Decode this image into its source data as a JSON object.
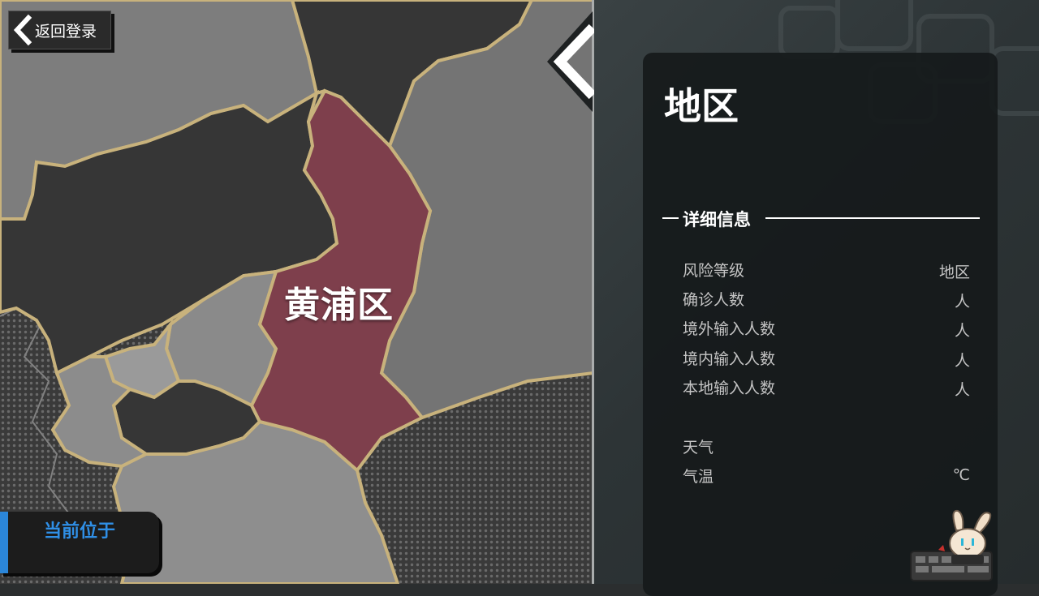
{
  "map": {
    "selected_district": "黄浦区",
    "colors": {
      "selected": "#7e3f4c",
      "border": "#c8b27c",
      "dark": "#353535",
      "mid": "#707070",
      "light": "#8e8e8e"
    }
  },
  "back_button": {
    "label": "返回登录",
    "icon": "chevron-left-icon"
  },
  "location": {
    "label": "当前位于",
    "value": ""
  },
  "collapse_button": {
    "icon": "chevron-left-icon"
  },
  "panel": {
    "title": "地区",
    "section_title": "详细信息",
    "rows": [
      {
        "label": "风险等级",
        "value": "地区"
      },
      {
        "label": "确诊人数",
        "value": "人"
      },
      {
        "label": "境外输入人数",
        "value": "人"
      },
      {
        "label": "境内输入人数",
        "value": "人"
      },
      {
        "label": "本地输入人数",
        "value": "人"
      },
      {
        "label": "天气",
        "value": ""
      },
      {
        "label": "气温",
        "value": "℃"
      }
    ]
  },
  "mascot": {
    "icon": "bunny-mascot-icon"
  }
}
